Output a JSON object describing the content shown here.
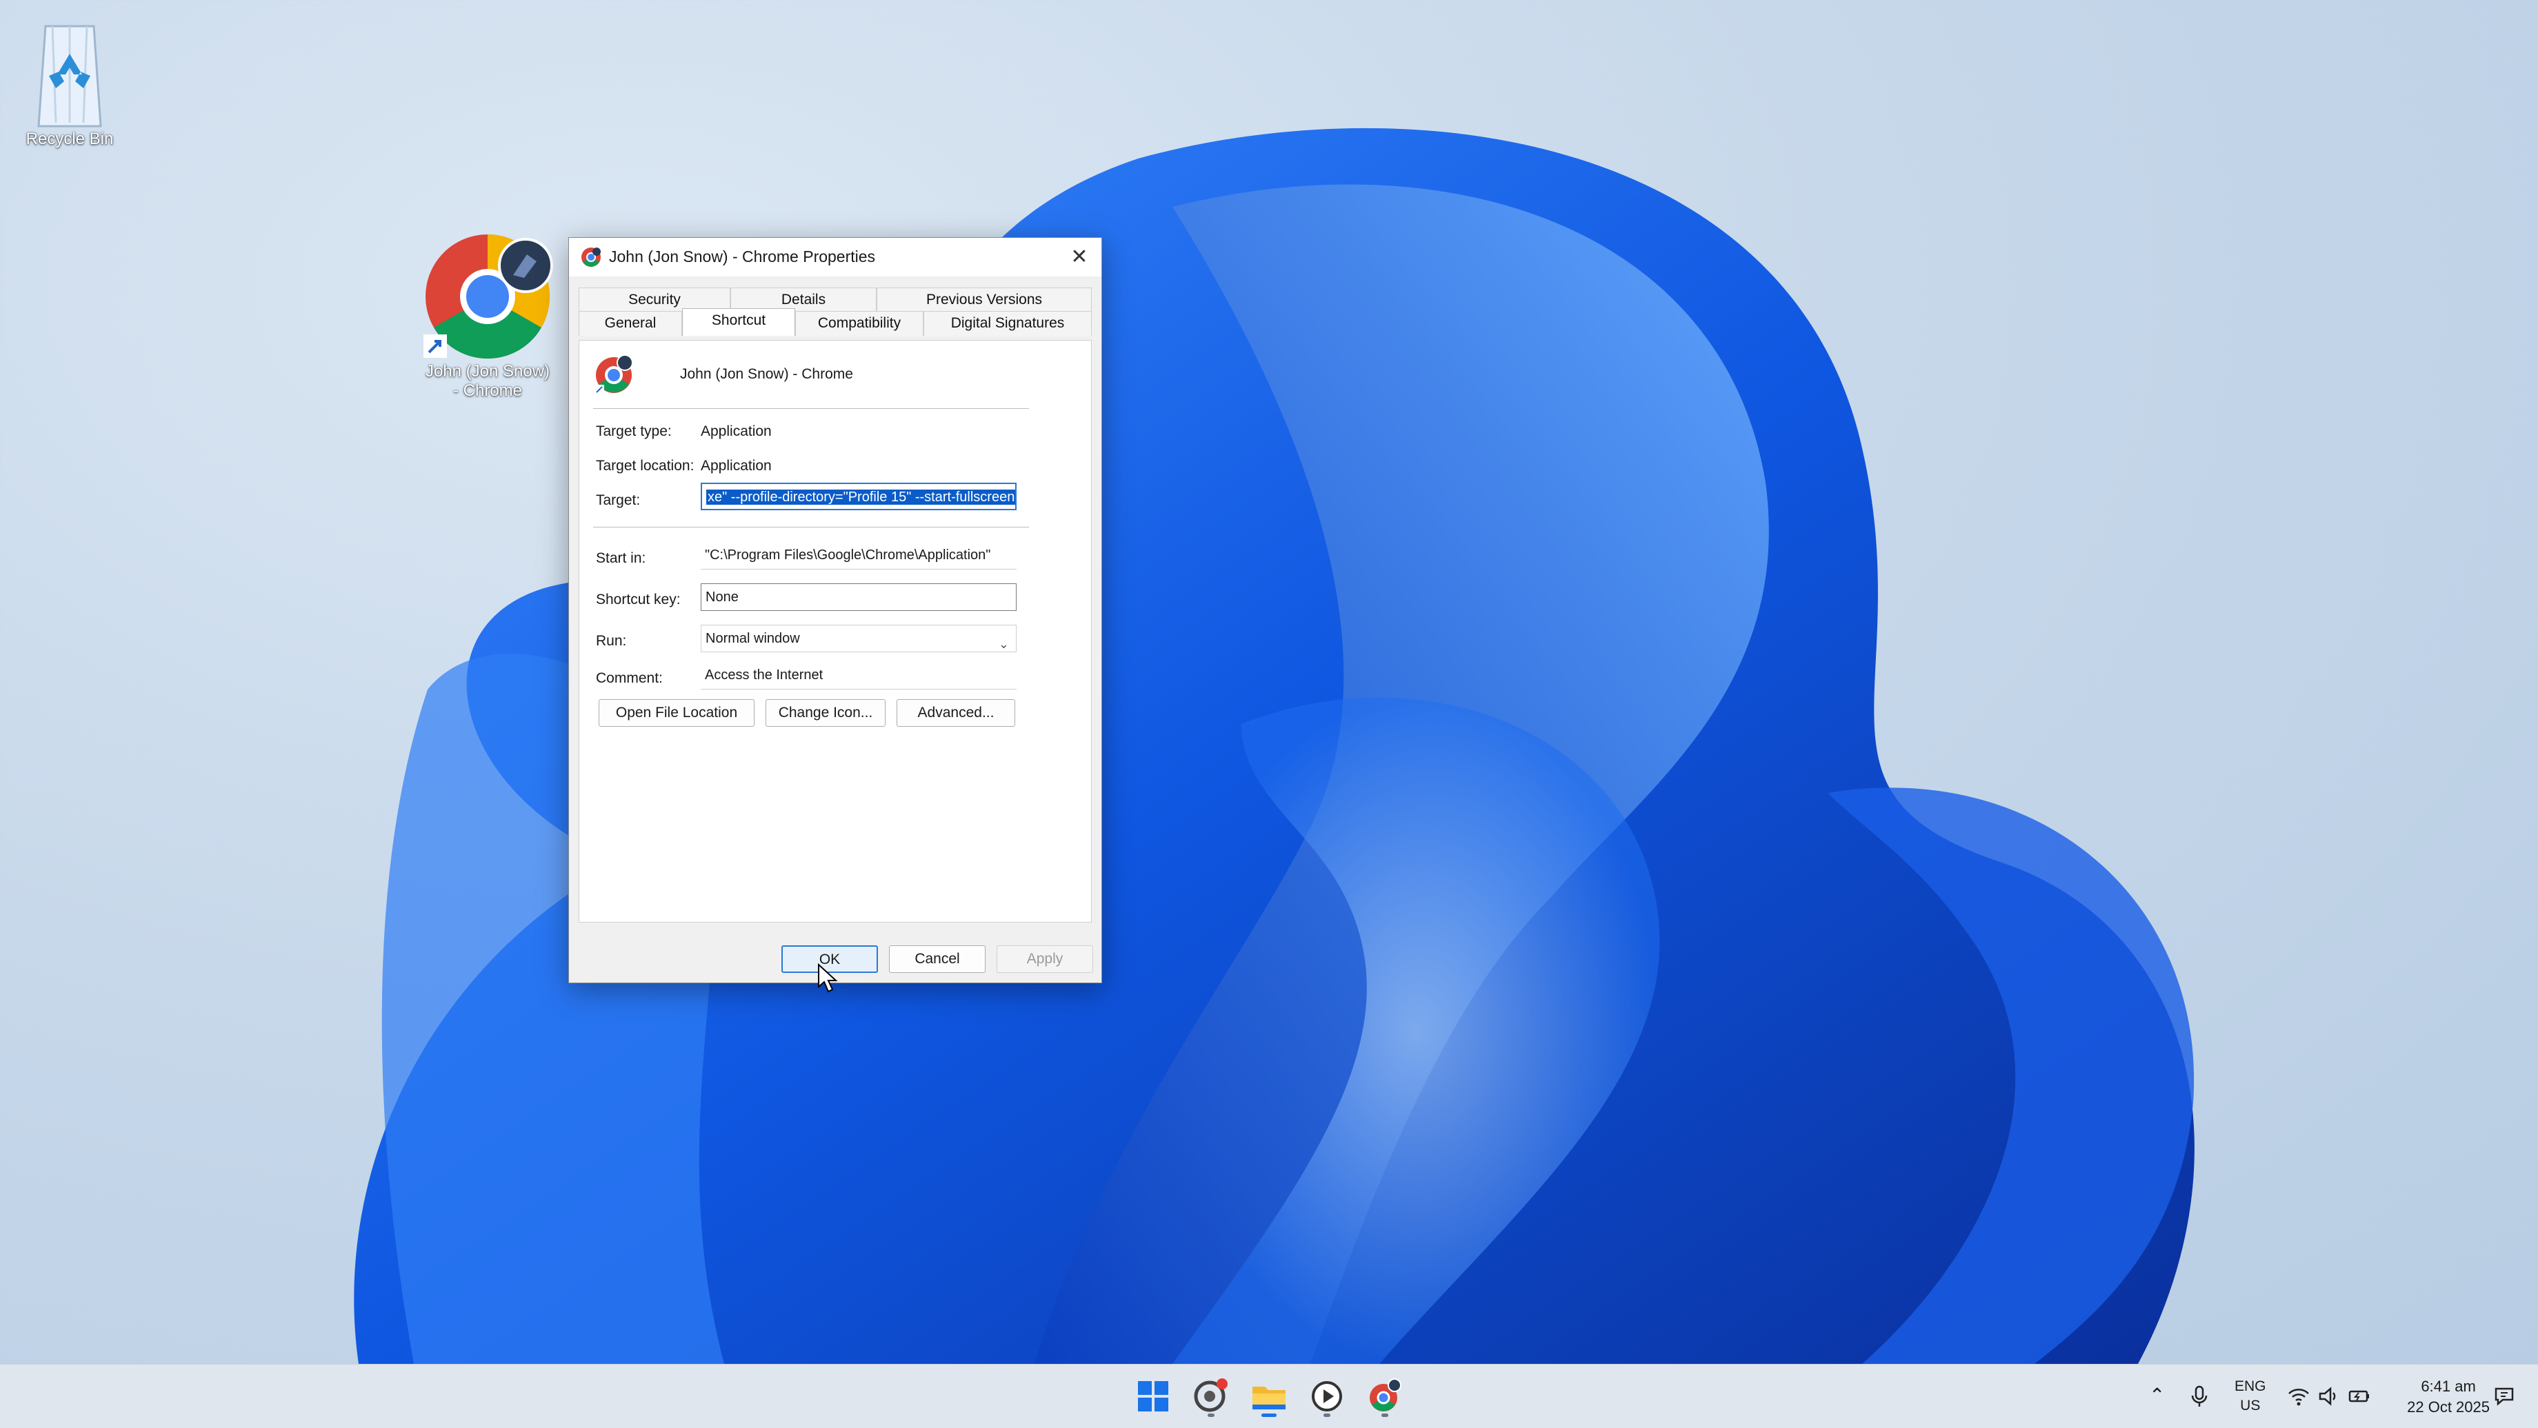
{
  "desktop": {
    "recycle_bin_label": "Recycle Bin",
    "chrome_shortcut_label": "John (Jon Snow) - Chrome"
  },
  "dialog": {
    "title": "John (Jon Snow) - Chrome Properties",
    "tabs_row1": [
      "Security",
      "Details",
      "Previous Versions"
    ],
    "tabs_row2": [
      "General",
      "Shortcut",
      "Compatibility",
      "Digital Signatures"
    ],
    "active_tab": "Shortcut",
    "shortcut_name": "John (Jon Snow) - Chrome",
    "target_type_label": "Target type:",
    "target_type_value": "Application",
    "target_location_label": "Target location:",
    "target_location_value": "Application",
    "target_label": "Target:",
    "target_value": "xe\" --profile-directory=\"Profile 15\" --start-fullscreen",
    "start_in_label": "Start in:",
    "start_in_value": "\"C:\\Program Files\\Google\\Chrome\\Application\"",
    "shortcut_key_label": "Shortcut key:",
    "shortcut_key_value": "None",
    "run_label": "Run:",
    "run_value": "Normal window",
    "comment_label": "Comment:",
    "comment_value": "Access the Internet",
    "open_file_location": "Open File Location",
    "change_icon": "Change Icon...",
    "advanced": "Advanced...",
    "ok": "OK",
    "cancel": "Cancel",
    "apply": "Apply"
  },
  "taskbar": {
    "apps": [
      "start-icon",
      "chrome-notification-icon",
      "file-explorer-icon",
      "media-player-icon",
      "chrome-profile-icon"
    ],
    "lang_top": "ENG",
    "lang_bottom": "US",
    "time": "6:41 am",
    "date": "22 Oct 2025"
  },
  "colors": {
    "accent": "#0a5cc9",
    "wallpaper_blue": "#1560e6"
  }
}
